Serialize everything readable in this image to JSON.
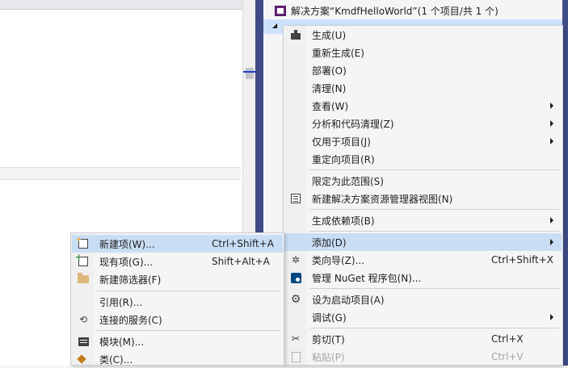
{
  "solution_explorer": {
    "solution_label": "解决方案“KmdfHelloWorld”(1 个项目/共 1 个)"
  },
  "project_menu": {
    "items": [
      {
        "label": "生成(U)",
        "icon": "build-icon"
      },
      {
        "label": "重新生成(E)"
      },
      {
        "label": "部署(O)"
      },
      {
        "label": "清理(N)"
      },
      {
        "label": "查看(W)",
        "submenu": true
      },
      {
        "label": "分析和代码清理(Z)",
        "submenu": true
      },
      {
        "label": "仅用于项目(J)",
        "submenu": true
      },
      {
        "label": "重定向项目(R)"
      },
      {
        "label": "限定为此范围(S)"
      },
      {
        "label": "新建解决方案资源管理器视图(N)",
        "icon": "new-view-icon"
      },
      {
        "label": "生成依赖项(B)",
        "submenu": true
      },
      {
        "label": "添加(D)",
        "submenu": true,
        "highlighted": true
      },
      {
        "label": "类向导(Z)...",
        "shortcut": "Ctrl+Shift+X",
        "icon": "class-wizard-icon"
      },
      {
        "label": "管理 NuGet 程序包(N)...",
        "icon": "nuget-icon"
      },
      {
        "label": "设为启动项目(A)",
        "icon": "gear-icon"
      },
      {
        "label": "调试(G)",
        "submenu": true
      },
      {
        "label": "剪切(T)",
        "shortcut": "Ctrl+X",
        "icon": "cut-icon"
      },
      {
        "label": "粘贴(P)",
        "shortcut": "Ctrl+V",
        "icon": "paste-icon",
        "disabled": true
      }
    ]
  },
  "add_submenu": {
    "items": [
      {
        "label": "新建项(W)...",
        "shortcut": "Ctrl+Shift+A",
        "icon": "new-item-icon",
        "highlighted": true
      },
      {
        "label": "现有项(G)...",
        "shortcut": "Shift+Alt+A",
        "icon": "existing-item-icon"
      },
      {
        "label": "新建筛选器(F)",
        "icon": "new-filter-folder-icon"
      },
      {
        "label": "引用(R)..."
      },
      {
        "label": "连接的服务(C)",
        "icon": "connected-service-icon"
      },
      {
        "label": "模块(M)...",
        "icon": "module-icon"
      },
      {
        "label": "类(C)...",
        "icon": "class-icon"
      }
    ]
  }
}
